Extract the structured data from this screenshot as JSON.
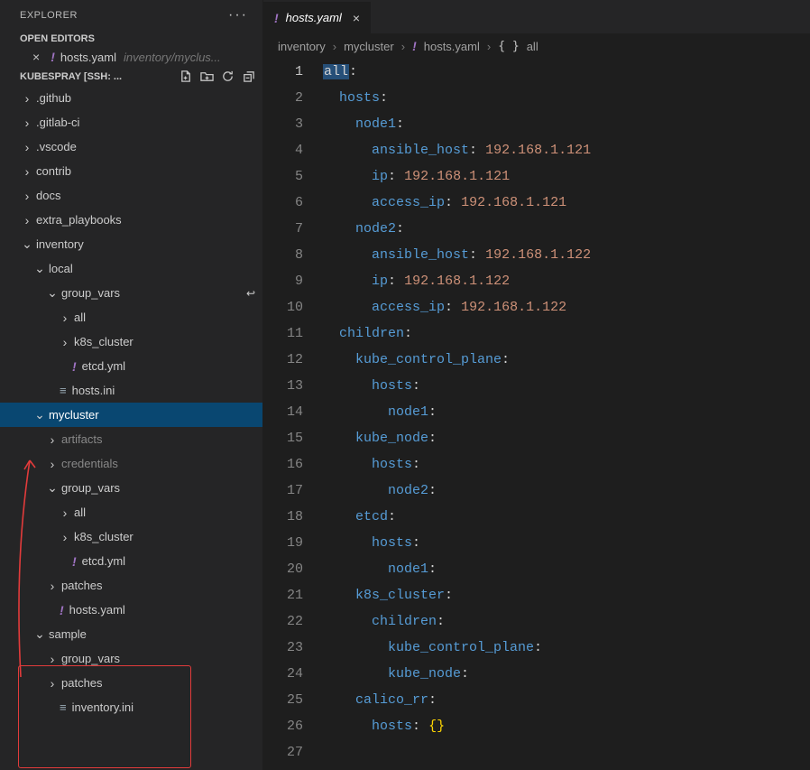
{
  "explorer": {
    "title": "EXPLORER",
    "open_editors_label": "OPEN EDITORS",
    "workspace_label": "KUBESPRAY [SSH: ...",
    "open_editor": {
      "name": "hosts.yaml",
      "path": "inventory/myclus..."
    }
  },
  "tree": {
    "github": ".github",
    "gitlab_ci": ".gitlab-ci",
    "vscode": ".vscode",
    "contrib": "contrib",
    "docs": "docs",
    "extra_playbooks": "extra_playbooks",
    "inventory": "inventory",
    "local": "local",
    "group_vars": "group_vars",
    "all": "all",
    "k8s_cluster": "k8s_cluster",
    "etcd_yml": "etcd.yml",
    "hosts_ini": "hosts.ini",
    "mycluster": "mycluster",
    "artifacts": "artifacts",
    "credentials": "credentials",
    "patches": "patches",
    "hosts_yaml": "hosts.yaml",
    "sample": "sample",
    "inventory_ini": "inventory.ini"
  },
  "tab": {
    "title": "hosts.yaml"
  },
  "breadcrumb": {
    "seg0": "inventory",
    "seg1": "mycluster",
    "seg2": "hosts.yaml",
    "seg3": "all",
    "sep": "›"
  },
  "code": {
    "lines": [
      {
        "n": 1,
        "indent": 0,
        "key": "all",
        "sel": true
      },
      {
        "n": 2,
        "indent": 1,
        "key": "hosts"
      },
      {
        "n": 3,
        "indent": 2,
        "key": "node1"
      },
      {
        "n": 4,
        "indent": 3,
        "key": "ansible_host",
        "val": "192.168.1.121"
      },
      {
        "n": 5,
        "indent": 3,
        "key": "ip",
        "val": "192.168.1.121"
      },
      {
        "n": 6,
        "indent": 3,
        "key": "access_ip",
        "val": "192.168.1.121"
      },
      {
        "n": 7,
        "indent": 2,
        "key": "node2"
      },
      {
        "n": 8,
        "indent": 3,
        "key": "ansible_host",
        "val": "192.168.1.122"
      },
      {
        "n": 9,
        "indent": 3,
        "key": "ip",
        "val": "192.168.1.122"
      },
      {
        "n": 10,
        "indent": 3,
        "key": "access_ip",
        "val": "192.168.1.122"
      },
      {
        "n": 11,
        "indent": 1,
        "key": "children"
      },
      {
        "n": 12,
        "indent": 2,
        "key": "kube_control_plane"
      },
      {
        "n": 13,
        "indent": 3,
        "key": "hosts"
      },
      {
        "n": 14,
        "indent": 4,
        "key": "node1"
      },
      {
        "n": 15,
        "indent": 2,
        "key": "kube_node"
      },
      {
        "n": 16,
        "indent": 3,
        "key": "hosts"
      },
      {
        "n": 17,
        "indent": 4,
        "key": "node2"
      },
      {
        "n": 18,
        "indent": 2,
        "key": "etcd"
      },
      {
        "n": 19,
        "indent": 3,
        "key": "hosts"
      },
      {
        "n": 20,
        "indent": 4,
        "key": "node1"
      },
      {
        "n": 21,
        "indent": 2,
        "key": "k8s_cluster"
      },
      {
        "n": 22,
        "indent": 3,
        "key": "children"
      },
      {
        "n": 23,
        "indent": 4,
        "key": "kube_control_plane"
      },
      {
        "n": 24,
        "indent": 4,
        "key": "kube_node"
      },
      {
        "n": 25,
        "indent": 2,
        "key": "calico_rr"
      },
      {
        "n": 26,
        "indent": 3,
        "key": "hosts",
        "braces": true
      },
      {
        "n": 27,
        "indent": 0
      }
    ]
  }
}
